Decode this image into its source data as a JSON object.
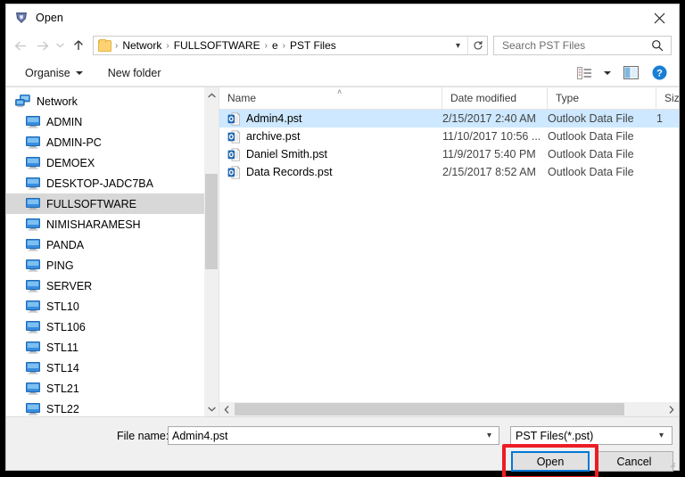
{
  "window": {
    "title": "Open",
    "title_icon": "app-shield-icon",
    "close_label": "✕"
  },
  "navbar": {
    "back_icon": "arrow-left-icon",
    "forward_icon": "arrow-right-icon",
    "history_icon": "chevron-down-icon",
    "up_icon": "arrow-up-icon",
    "breadcrumbs": [
      "Network",
      "FULLSOFTWARE",
      "e",
      "PST Files"
    ],
    "separator": "›",
    "dropdown_icon": "chevron-down-icon",
    "refresh_icon": "refresh-icon"
  },
  "search": {
    "placeholder": "Search PST Files",
    "value": "",
    "icon": "search-icon"
  },
  "command_bar": {
    "organise_label": "Organise",
    "new_folder_label": "New folder",
    "view_icon": "list-view-icon",
    "view_caret_icon": "chevron-down-icon",
    "preview_pane_icon": "preview-pane-icon",
    "help_icon": "help-icon"
  },
  "nav_pane": {
    "items": [
      {
        "label": "Network",
        "icon": "network-icon",
        "level": 0,
        "selected": false
      },
      {
        "label": "ADMIN",
        "icon": "computer-icon",
        "level": 1,
        "selected": false
      },
      {
        "label": "ADMIN-PC",
        "icon": "computer-icon",
        "level": 1,
        "selected": false
      },
      {
        "label": "DEMOEX",
        "icon": "computer-icon",
        "level": 1,
        "selected": false
      },
      {
        "label": "DESKTOP-JADC7BA",
        "icon": "computer-icon",
        "level": 1,
        "selected": false
      },
      {
        "label": "FULLSOFTWARE",
        "icon": "computer-icon",
        "level": 1,
        "selected": true
      },
      {
        "label": "NIMISHARAMESH",
        "icon": "computer-icon",
        "level": 1,
        "selected": false
      },
      {
        "label": "PANDA",
        "icon": "computer-icon",
        "level": 1,
        "selected": false
      },
      {
        "label": "PING",
        "icon": "computer-icon",
        "level": 1,
        "selected": false
      },
      {
        "label": "SERVER",
        "icon": "computer-icon",
        "level": 1,
        "selected": false
      },
      {
        "label": "STL10",
        "icon": "computer-icon",
        "level": 1,
        "selected": false
      },
      {
        "label": "STL106",
        "icon": "computer-icon",
        "level": 1,
        "selected": false
      },
      {
        "label": "STL11",
        "icon": "computer-icon",
        "level": 1,
        "selected": false
      },
      {
        "label": "STL14",
        "icon": "computer-icon",
        "level": 1,
        "selected": false
      },
      {
        "label": "STL21",
        "icon": "computer-icon",
        "level": 1,
        "selected": false
      },
      {
        "label": "STL22",
        "icon": "computer-icon",
        "level": 1,
        "selected": false
      }
    ],
    "scrollbar": {
      "up_icon": "chevron-up-icon",
      "down_icon": "chevron-down-icon"
    }
  },
  "file_list": {
    "columns": [
      "Name",
      "Date modified",
      "Type",
      "Size"
    ],
    "sort_column": "Name",
    "sort_indicator": "˄",
    "rows": [
      {
        "name": "Admin4.pst",
        "date": "2/15/2017 2:40 AM",
        "type": "Outlook Data File",
        "size": "1",
        "icon": "outlook-pst-icon",
        "selected": true
      },
      {
        "name": "archive.pst",
        "date": "11/10/2017 10:56 ...",
        "type": "Outlook Data File",
        "size": "",
        "icon": "outlook-pst-icon",
        "selected": false
      },
      {
        "name": "Daniel Smith.pst",
        "date": "11/9/2017 5:40 PM",
        "type": "Outlook Data File",
        "size": "",
        "icon": "outlook-pst-icon",
        "selected": false
      },
      {
        "name": "Data Records.pst",
        "date": "2/15/2017 8:52 AM",
        "type": "Outlook Data File",
        "size": "",
        "icon": "outlook-pst-icon",
        "selected": false
      }
    ],
    "hscrollbar": {
      "left_icon": "chevron-left-icon",
      "right_icon": "chevron-right-icon"
    }
  },
  "footer": {
    "file_name_label": "File name:",
    "file_name_value": "Admin4.pst",
    "file_name_caret": "chevron-down-icon",
    "file_type_value": "PST Files(*.pst)",
    "file_type_caret": "chevron-down-icon",
    "open_label": "Open",
    "cancel_label": "Cancel"
  },
  "annotation": {
    "highlight_target": "Open",
    "highlight_color": "#ed1c24"
  }
}
